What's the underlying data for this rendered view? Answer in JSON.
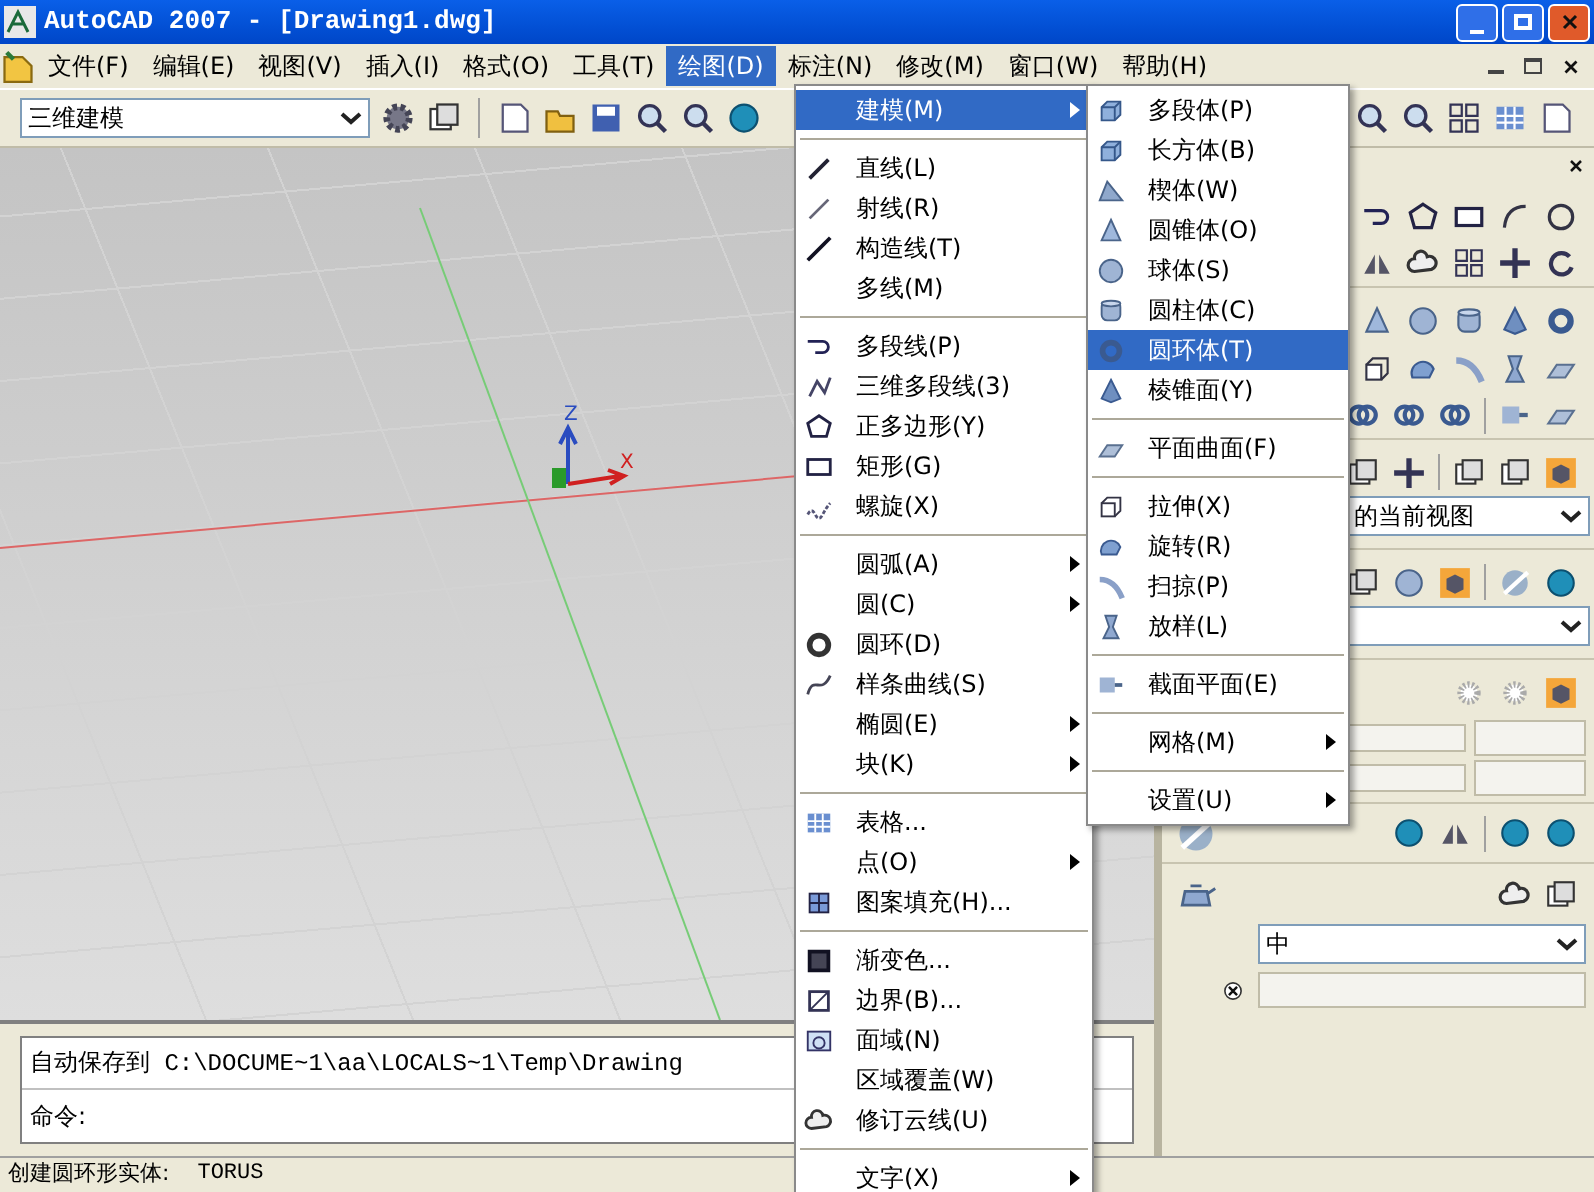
{
  "window": {
    "title": "AutoCAD 2007 - [Drawing1.dwg]"
  },
  "menu_bar": [
    {
      "label": "文件(F)",
      "selected": false
    },
    {
      "label": "编辑(E)",
      "selected": false
    },
    {
      "label": "视图(V)",
      "selected": false
    },
    {
      "label": "插入(I)",
      "selected": false
    },
    {
      "label": "格式(O)",
      "selected": false
    },
    {
      "label": "工具(T)",
      "selected": false
    },
    {
      "label": "绘图(D)",
      "selected": true
    },
    {
      "label": "标注(N)",
      "selected": false
    },
    {
      "label": "修改(M)",
      "selected": false
    },
    {
      "label": "窗口(W)",
      "selected": false
    },
    {
      "label": "帮助(H)",
      "selected": false
    }
  ],
  "workspace": {
    "value": "三维建模"
  },
  "viewport": {
    "ucs_z": "Z",
    "ucs_x": "X"
  },
  "draw_menu": {
    "sections": [
      [
        {
          "label": "建模(M)",
          "submenu": true,
          "selected": true
        }
      ],
      [
        {
          "label": "直线(L)",
          "submenu": false,
          "selected": false
        },
        {
          "label": "射线(R)",
          "submenu": false,
          "selected": false
        },
        {
          "label": "构造线(T)",
          "submenu": false,
          "selected": false
        },
        {
          "label": "多线(M)",
          "submenu": false,
          "selected": false
        }
      ],
      [
        {
          "label": "多段线(P)",
          "submenu": false,
          "selected": false
        },
        {
          "label": "三维多段线(3)",
          "submenu": false,
          "selected": false
        },
        {
          "label": "正多边形(Y)",
          "submenu": false,
          "selected": false
        },
        {
          "label": "矩形(G)",
          "submenu": false,
          "selected": false
        },
        {
          "label": "螺旋(X)",
          "submenu": false,
          "selected": false
        }
      ],
      [
        {
          "label": "圆弧(A)",
          "submenu": true,
          "selected": false
        },
        {
          "label": "圆(C)",
          "submenu": true,
          "selected": false
        },
        {
          "label": "圆环(D)",
          "submenu": false,
          "selected": false
        },
        {
          "label": "样条曲线(S)",
          "submenu": false,
          "selected": false
        },
        {
          "label": "椭圆(E)",
          "submenu": true,
          "selected": false
        },
        {
          "label": "块(K)",
          "submenu": true,
          "selected": false
        }
      ],
      [
        {
          "label": "表格...",
          "submenu": false,
          "selected": false
        },
        {
          "label": "点(O)",
          "submenu": true,
          "selected": false
        },
        {
          "label": "图案填充(H)...",
          "submenu": false,
          "selected": false
        }
      ],
      [
        {
          "label": "渐变色...",
          "submenu": false,
          "selected": false
        },
        {
          "label": "边界(B)...",
          "submenu": false,
          "selected": false
        },
        {
          "label": "面域(N)",
          "submenu": false,
          "selected": false
        },
        {
          "label": "区域覆盖(W)",
          "submenu": false,
          "selected": false
        },
        {
          "label": "修订云线(U)",
          "submenu": false,
          "selected": false
        }
      ],
      [
        {
          "label": "文字(X)",
          "submenu": true,
          "selected": false
        }
      ]
    ]
  },
  "modeling_submenu": {
    "sections": [
      [
        {
          "label": "多段体(P)",
          "submenu": false,
          "selected": false
        },
        {
          "label": "长方体(B)",
          "submenu": false,
          "selected": false
        },
        {
          "label": "楔体(W)",
          "submenu": false,
          "selected": false
        },
        {
          "label": "圆锥体(O)",
          "submenu": false,
          "selected": false
        },
        {
          "label": "球体(S)",
          "submenu": false,
          "selected": false
        },
        {
          "label": "圆柱体(C)",
          "submenu": false,
          "selected": false
        },
        {
          "label": "圆环体(T)",
          "submenu": false,
          "selected": true
        },
        {
          "label": "棱锥面(Y)",
          "submenu": false,
          "selected": false
        }
      ],
      [
        {
          "label": "平面曲面(F)",
          "submenu": false,
          "selected": false
        }
      ],
      [
        {
          "label": "拉伸(X)",
          "submenu": false,
          "selected": false
        },
        {
          "label": "旋转(R)",
          "submenu": false,
          "selected": false
        },
        {
          "label": "扫掠(P)",
          "submenu": false,
          "selected": false
        },
        {
          "label": "放样(L)",
          "submenu": false,
          "selected": false
        }
      ],
      [
        {
          "label": "截面平面(E)",
          "submenu": false,
          "selected": false
        }
      ],
      [
        {
          "label": "网格(M)",
          "submenu": true,
          "selected": false
        }
      ],
      [
        {
          "label": "设置(U)",
          "submenu": true,
          "selected": false
        }
      ]
    ]
  },
  "dashboard": {
    "view_dropdown": "的当前视图",
    "visual_style_dropdown": "中"
  },
  "command_line": {
    "history": "自动保存到 C:\\DOCUME~1\\aa\\LOCALS~1\\Temp\\Drawing",
    "prompt": "命令:"
  },
  "status_bar": {
    "message": "创建圆环形实体:",
    "command": "TORUS"
  }
}
